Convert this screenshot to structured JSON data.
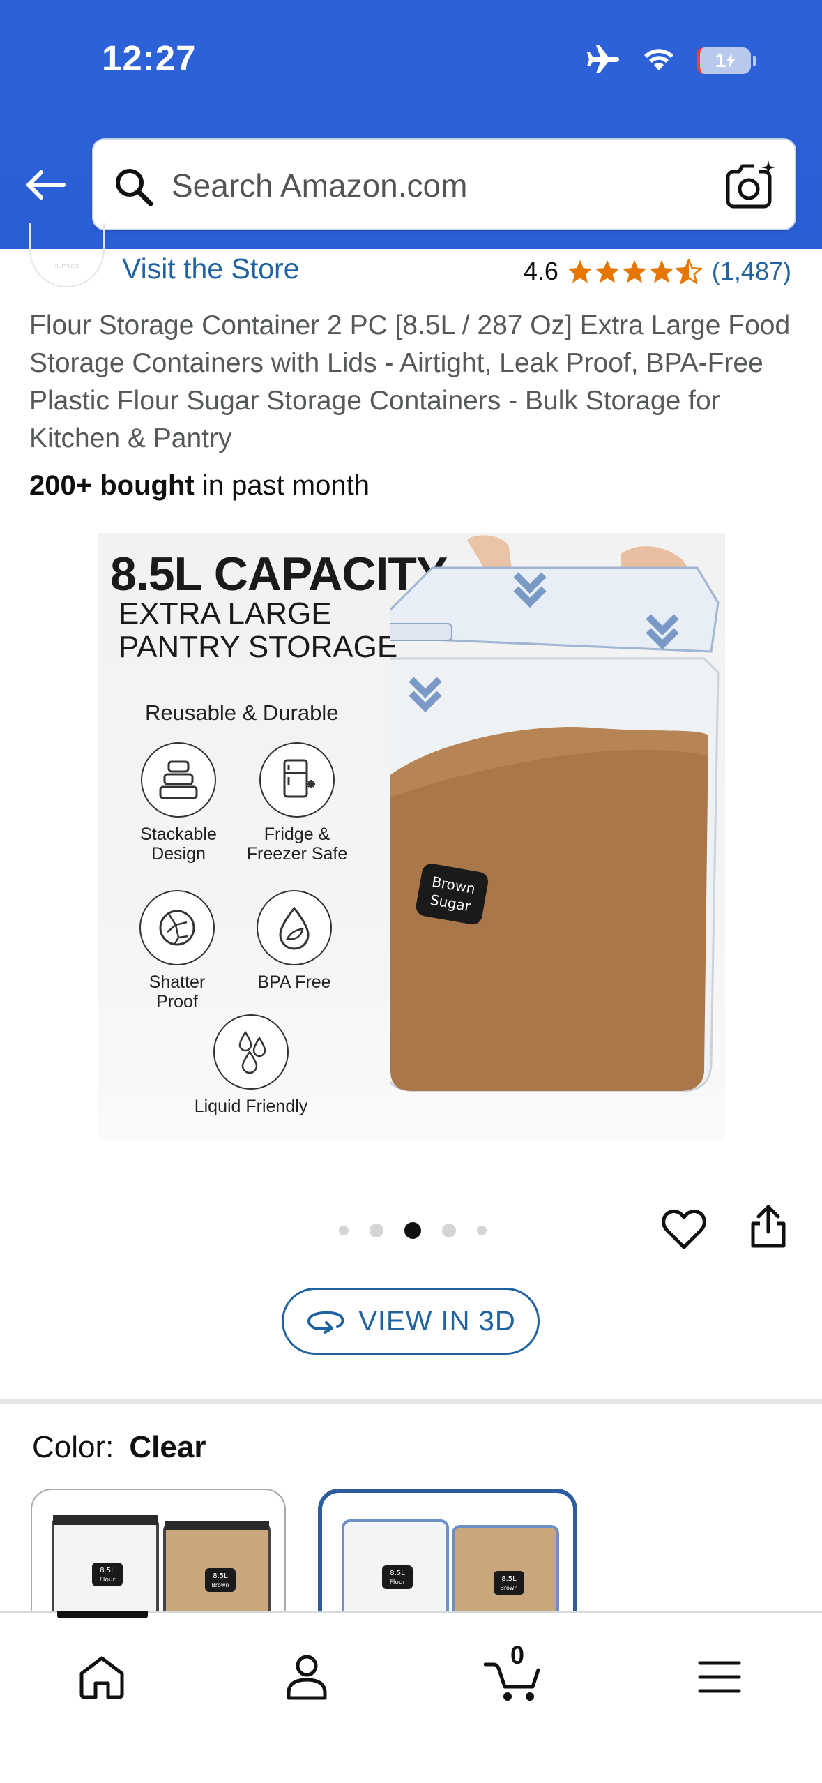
{
  "status_bar": {
    "time": "12:27",
    "battery": "1"
  },
  "search": {
    "placeholder": "Search Amazon.com"
  },
  "store": {
    "visit_label": "Visit the Store",
    "logo_text": "SUPPLIES"
  },
  "rating": {
    "value": "4.6",
    "stars": 4.5,
    "count": "(1,487)"
  },
  "product": {
    "title": "Flour Storage Container 2 PC [8.5L / 287 Oz] Extra Large Food Storage Containers with Lids - Airtight, Leak Proof, BPA-Free Plastic Flour Sugar Storage Containers - Bulk Storage for Kitchen & Pantry",
    "bought_bold": "200+ bought",
    "bought_rest": " in past month"
  },
  "image": {
    "headline": "8.5L CAPACITY",
    "sub_line1": "EXTRA LARGE",
    "sub_line2": "PANTRY STORAGE",
    "features_title": "Reusable & Durable",
    "features": [
      {
        "label_1": "Stackable",
        "label_2": "Design",
        "icon": "stack-boxes-icon"
      },
      {
        "label_1": "Fridge &",
        "label_2": "Freezer Safe",
        "icon": "fridge-icon"
      },
      {
        "label_1": "Shatter",
        "label_2": "Proof",
        "icon": "shatter-icon"
      },
      {
        "label_1": "BPA Free",
        "label_2": "",
        "icon": "leaf-drop-icon"
      },
      {
        "label_1": "Liquid Friendly",
        "label_2": "",
        "icon": "droplets-icon"
      }
    ],
    "jar_label_1": "Brown",
    "jar_label_2": "Sugar"
  },
  "carousel": {
    "count": 5,
    "active_index": 2
  },
  "view3d": {
    "label": "VIEW IN 3D"
  },
  "color": {
    "label": "Color:",
    "value": "Clear"
  },
  "swatches": [
    {
      "left_label_1": "8.5L",
      "left_label_2": "Flour",
      "right_label_1": "8.5L",
      "right_label_2": "Brown"
    },
    {
      "left_label_1": "8.5L",
      "left_label_2": "Flour",
      "right_label_1": "8.5L",
      "right_label_2": "Brown"
    }
  ],
  "bottom_nav": {
    "cart_count": "0"
  },
  "colors": {
    "header_blue": "#2a5ed6",
    "link_blue": "#2162a1",
    "star_orange": "#e77600",
    "selected_border": "#2e5d9f"
  }
}
